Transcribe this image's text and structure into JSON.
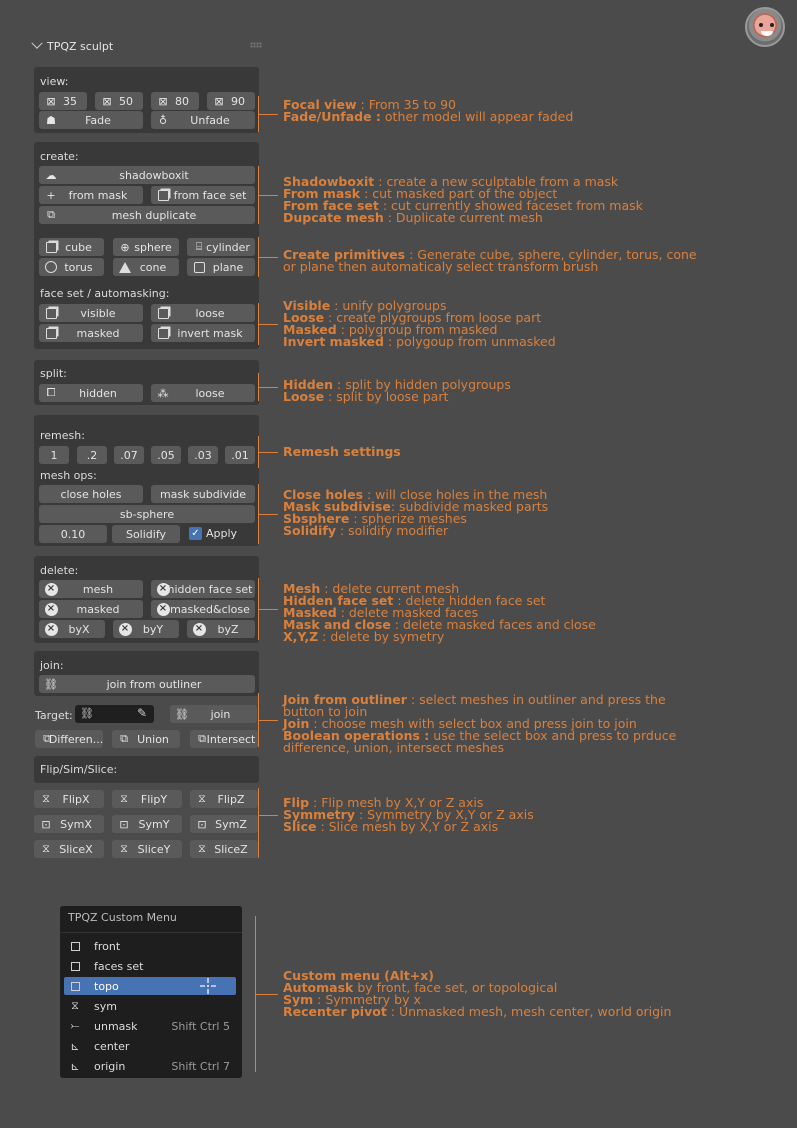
{
  "header": {
    "title": "TPQZ sculpt"
  },
  "view": {
    "label": "view:",
    "focals": [
      "35",
      "50",
      "80",
      "90"
    ],
    "fade": "Fade",
    "unfade": "Unfade"
  },
  "create": {
    "label": "create:",
    "shadowboxit": "shadowboxit",
    "from_mask": "from mask",
    "from_face_set": "from face set",
    "mesh_duplicate": "mesh duplicate",
    "cube": "cube",
    "sphere": "sphere",
    "cylinder": "cylinder",
    "torus": "torus",
    "cone": "cone",
    "plane": "plane",
    "faceset_label": "face set / automasking:",
    "visible": "visible",
    "loose": "loose",
    "masked": "masked",
    "invert_mask": "invert mask"
  },
  "split": {
    "label": "split:",
    "hidden": "hidden",
    "loose": "loose"
  },
  "remesh": {
    "label": "remesh:",
    "values": [
      "1",
      ".2",
      ".07",
      ".05",
      ".03",
      ".01"
    ],
    "mesh_ops_label": "mesh ops:",
    "close_holes": "close holes",
    "mask_subdivide": "mask subdivide",
    "sb_sphere": "sb-sphere",
    "solidify_value": "0.10",
    "solidify": "Solidify",
    "apply": "Apply"
  },
  "delete": {
    "label": "delete:",
    "mesh": "mesh",
    "hidden_face_set": "hidden face set",
    "masked": "masked",
    "masked_close": "masked&close",
    "byX": "byX",
    "byY": "byY",
    "byZ": "byZ"
  },
  "join": {
    "label": "join:",
    "join_from_outliner": "join from outliner",
    "target_label": "Target:",
    "join": "join",
    "difference": "Differen...",
    "union": "Union",
    "intersect": "Intersect"
  },
  "flip": {
    "label": "Flip/Sim/Slice:",
    "flipX": "FlipX",
    "flipY": "FlipY",
    "flipZ": "FlipZ",
    "symX": "SymX",
    "symY": "SymY",
    "symZ": "SymZ",
    "sliceX": "SliceX",
    "sliceY": "SliceY",
    "sliceZ": "SliceZ"
  },
  "menu": {
    "title": "TPQZ Custom Menu",
    "items": [
      {
        "label": "front",
        "shortcut": ""
      },
      {
        "label": "faces set",
        "shortcut": ""
      },
      {
        "label": "topo",
        "shortcut": ""
      },
      {
        "label": "sym",
        "shortcut": ""
      },
      {
        "label": "unmask",
        "shortcut": "Shift Ctrl 5"
      },
      {
        "label": "center",
        "shortcut": ""
      },
      {
        "label": "origin",
        "shortcut": "Shift Ctrl 7"
      }
    ]
  },
  "annotations": {
    "a1": {
      "b1": "Focal view",
      "t1": " : From 35 to 90",
      "b2": "Fade/Unfade :",
      "t2": " other model will appear faded"
    },
    "a2": {
      "b1": "Shadowboxit",
      "t1": " : create a new sculptable  from a mask",
      "b2": "From mask",
      "t2": " : cut masked part of the object",
      "b3": "From face set",
      "t3": " : cut currently showed  faceset  from mask",
      "b4": "Dupcate mesh",
      "t4": " : Duplicate current mesh"
    },
    "a3": {
      "b1": "Create primitives",
      "t1": " : Generate  cube, sphere, cylinder, torus, cone",
      "t2": "or plane then automaticaly select transform brush"
    },
    "a4": {
      "b1": "Visible",
      "t1": " : unify polygroups",
      "b2": "Loose",
      "t2": " : create plygroups from loose part",
      "b3": "Masked",
      "t3": " : polygroup from masked",
      "b4": "Invert masked",
      "t4": " : polygoup from unmasked"
    },
    "a5": {
      "b1": "Hidden",
      "t1": " : split by hidden polygroups",
      "b2": "Loose",
      "t2": " : split by loose part"
    },
    "a6": {
      "b1": "Remesh settings"
    },
    "a7": {
      "b1": "Close holes",
      "t1": " : will close holes in the mesh",
      "b2": "Mask subdivise",
      "t2": ": subdivide masked parts",
      "b3": "Sbsphere",
      "t3": "  : spherize meshes",
      "b4": "Solidify",
      "t4": " : solidify modifier"
    },
    "a8": {
      "b1": "Mesh",
      "t1": " : delete current mesh",
      "b2": "Hidden face set",
      "t2": " : delete hidden face set",
      "b3": "Masked",
      "t3": " : delete masked faces",
      "b4": "Mask and close",
      "t4": " : delete masked faces and close",
      "b5": "X,Y,Z",
      "t5": " : delete  by symetry"
    },
    "a9": {
      "b1": "Join from outliner",
      "t1": " : select meshes in outliner and press the",
      "t1b": "button to join",
      "b2": "Join",
      "t2": " : choose mesh with select box and press join to join",
      "b3": "Boolean operations :",
      "t3": " use the select box and press to prduce",
      "t3b": "difference, union, intersect meshes"
    },
    "a10": {
      "b1": "Flip",
      "t1": " : Flip mesh by X,Y or Z axis",
      "b2": "Symmetry",
      "t2": " : Symmetry by X,Y or Z axis",
      "b3": "Slice",
      "t3": " : Slice mesh by X,Y or Z axis"
    },
    "a11": {
      "b1": "Custom menu (Alt+x)",
      "b2": "Automask",
      "t2": " by front, face set, or topological",
      "b3": "Sym",
      "t3": " : Symmetry by x",
      "b4": "Recenter pivot",
      "t4": " : Unmasked mesh, mesh center, world origin"
    }
  },
  "colors": {
    "accent": "#d9803d",
    "selection": "#4772b3",
    "panel": "#393939",
    "button": "#5a5a5a",
    "background": "#4b4b4b"
  }
}
